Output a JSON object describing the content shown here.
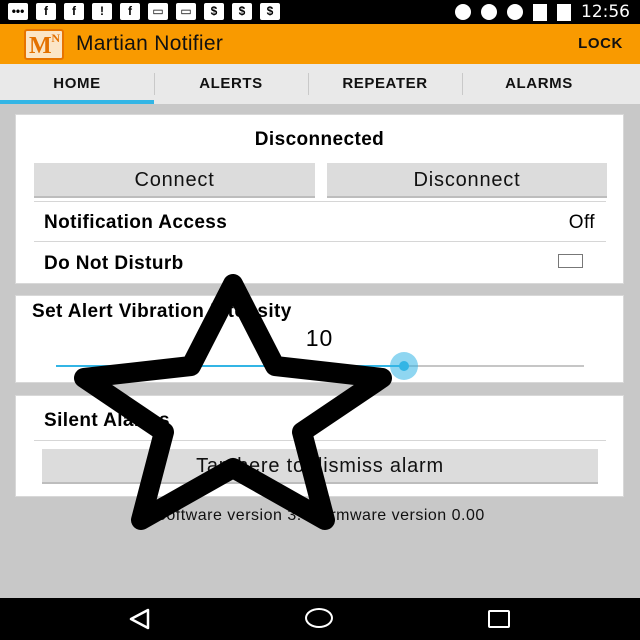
{
  "status_bar": {
    "time": "12:56"
  },
  "app": {
    "title": "Martian Notifier",
    "lock_label": "LOCK",
    "logo_letter": "M",
    "logo_badge": "N"
  },
  "tabs": [
    {
      "label": "HOME",
      "active": true
    },
    {
      "label": "ALERTS",
      "active": false
    },
    {
      "label": "REPEATER",
      "active": false
    },
    {
      "label": "ALARMS",
      "active": false
    }
  ],
  "connection": {
    "status": "Disconnected",
    "connect_label": "Connect",
    "disconnect_label": "Disconnect",
    "notification_access_label": "Notification Access",
    "notification_access_value": "Off",
    "do_not_disturb_label": "Do Not Disturb",
    "do_not_disturb_checked": false
  },
  "vibration": {
    "title": "Set Alert Vibration Intensity",
    "value": "10",
    "fraction": 0.66
  },
  "alarms": {
    "title": "Silent Alarms",
    "dismiss_label": "Tap here to dismiss alarm"
  },
  "footer": {
    "version_text": "Software version 3.0 Firmware version 0.00"
  },
  "colors": {
    "accent": "#33b5e5",
    "app_bar": "#f99a00",
    "overlay_star": "#000000"
  }
}
